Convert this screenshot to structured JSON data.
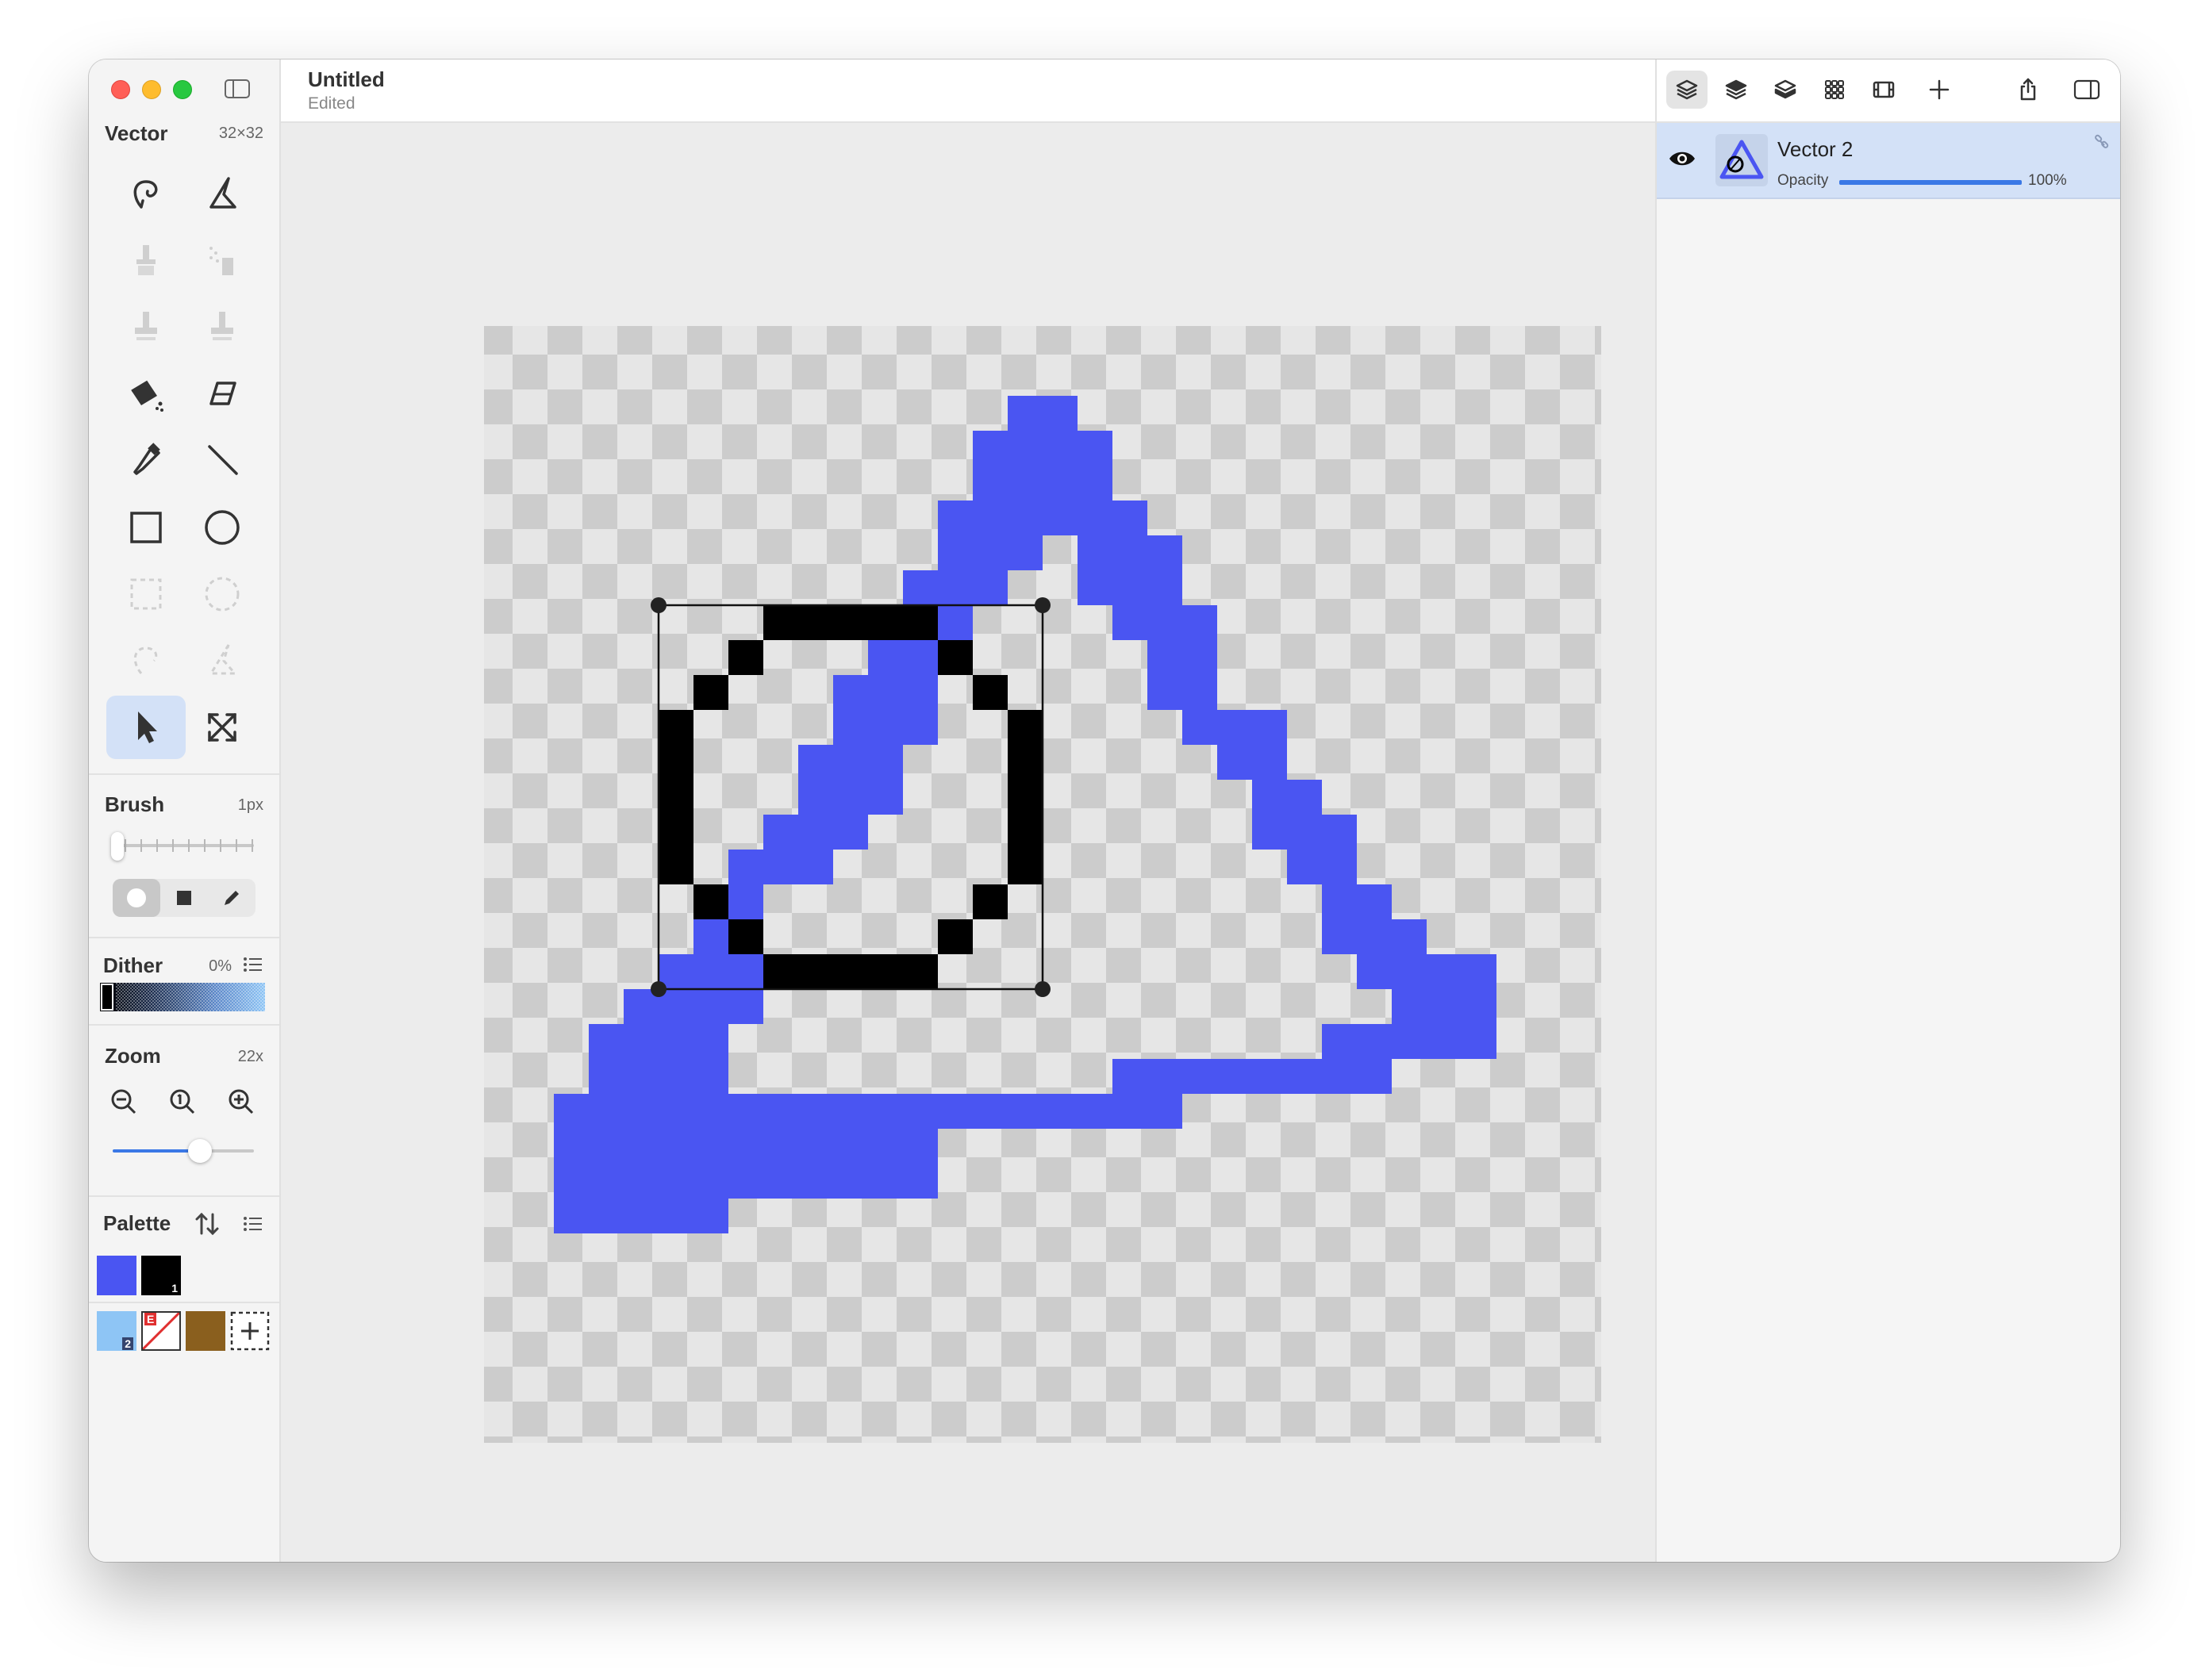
{
  "window": {
    "title": "Untitled",
    "subtitle": "Edited"
  },
  "tools_panel": {
    "title": "Vector",
    "canvas_size": "32×32",
    "tools": [
      "lasso-pen-icon",
      "pen-icon",
      "brush-icon",
      "spray-icon",
      "stamp-icon",
      "stamp-alt-icon",
      "bucket-icon",
      "eraser-icon",
      "eyedropper-icon",
      "line-icon",
      "rectangle-icon",
      "ellipse-icon",
      "rect-select-icon",
      "ellipse-select-icon",
      "lasso-select-icon",
      "magic-select-icon",
      "pointer-icon",
      "transform-icon"
    ],
    "active_tool": "pointer-icon"
  },
  "brush": {
    "title": "Brush",
    "size": "1px",
    "size_value": 1,
    "shapes": [
      "round",
      "square",
      "pencil"
    ],
    "selected_shape": "round"
  },
  "dither": {
    "title": "Dither",
    "value": "0%"
  },
  "zoom": {
    "title": "Zoom",
    "value": "22x",
    "level_fraction": 0.62
  },
  "palette": {
    "title": "Palette",
    "row1": [
      {
        "color": "#4a55f2",
        "label": ""
      },
      {
        "color": "#000000",
        "label": "1"
      }
    ],
    "row2": [
      {
        "color": "#8ec5f5",
        "label": "2"
      },
      {
        "color": "#ffffff",
        "label": "E"
      },
      {
        "color": "#8a5f1e",
        "label": ""
      },
      {
        "color": "",
        "label": "add"
      }
    ]
  },
  "layers": {
    "toolbar": [
      "layers-icon",
      "layers-alt-icon",
      "layers-stack-icon",
      "grid-icon",
      "film-icon",
      "add-icon",
      "share-icon",
      "sidebar-right-icon"
    ],
    "items": [
      {
        "name": "Vector 2",
        "opacity_label": "Opacity",
        "opacity_value": "100%",
        "opacity": 1.0,
        "visible": true,
        "selected": true
      }
    ]
  },
  "colors": {
    "accent": "#3a78e6",
    "fill_blue": "#4a55f2",
    "stroke_black": "#000000",
    "selection_highlight": "#d3e1f7"
  }
}
